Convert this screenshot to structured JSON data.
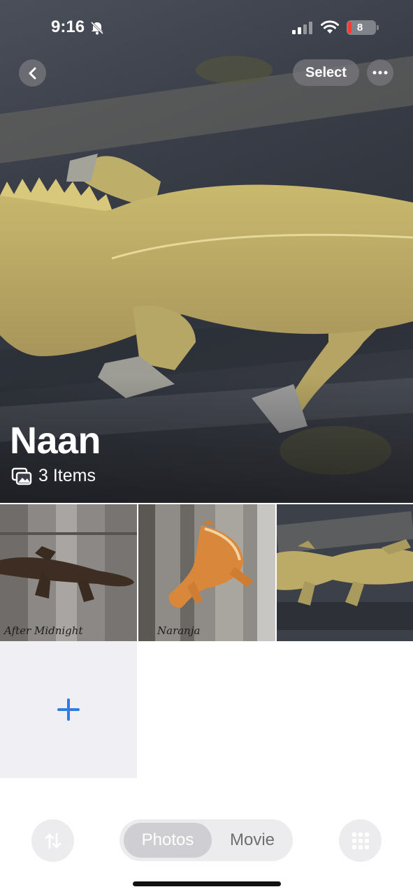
{
  "status_bar": {
    "time": "9:16",
    "battery": "8"
  },
  "nav": {
    "select_label": "Select"
  },
  "album": {
    "title": "Naan",
    "count": "3 Items"
  },
  "grid": {
    "items": [
      {
        "caption": "After Midnight"
      },
      {
        "caption": "Naranja"
      },
      {
        "caption": ""
      }
    ]
  },
  "toolbar": {
    "segments": [
      {
        "label": "Photos",
        "active": true
      },
      {
        "label": "Movie",
        "active": false
      }
    ]
  },
  "colors": {
    "accent": "#2f7de1",
    "battery_low": "#ff3b30"
  },
  "icons": [
    "bell-slash-icon",
    "signal-icon",
    "wifi-icon",
    "chevron-left-icon",
    "ellipsis-icon",
    "photo-stack-icon",
    "plus-icon",
    "sort-arrows-icon",
    "grid-icon"
  ]
}
